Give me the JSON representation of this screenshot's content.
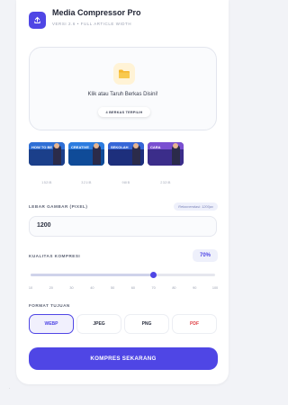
{
  "header": {
    "title": "Media Compressor Pro",
    "subtitle": "VERSI 2.6 • FULL ARTICLE WIDTH"
  },
  "dropzone": {
    "prompt": "Klik atau Taruh Berkas Disini!",
    "selected_count": "4 BERKAS TERPILIH"
  },
  "thumbnails": [
    {
      "text": "HOW TO BE",
      "label": "152IB",
      "colors": [
        "#2e6fd6",
        "#1b3f8a"
      ]
    },
    {
      "text": "CREATIVE",
      "label": "321IB",
      "colors": [
        "#2c7de0",
        "#0f4b98"
      ]
    },
    {
      "text": "SEKOLAH",
      "label": "98IB",
      "colors": [
        "#3566d8",
        "#1d2f7c"
      ]
    },
    {
      "text": "CARA",
      "label": "232IB",
      "colors": [
        "#7a4fd1",
        "#3b2d8a"
      ]
    }
  ],
  "width": {
    "label": "LEBAR GAMBAR (PIXEL)",
    "recommend": "Rekomendasi: 1200px",
    "value": "1200"
  },
  "quality": {
    "label": "KUALITAS KOMPRESI",
    "value_text": "70%",
    "value": 70,
    "min": 10,
    "max": 100,
    "ticks": [
      "10",
      "20",
      "30",
      "40",
      "50",
      "60",
      "70",
      "80",
      "90",
      "100"
    ]
  },
  "format": {
    "label": "FORMAT TUJUAN",
    "options": [
      "WEBP",
      "JPEG",
      "PNG",
      "PDF"
    ],
    "selected": "WEBP"
  },
  "actions": {
    "compress": "KOMPRES SEKARANG"
  },
  "footer_mark": ".",
  "colors": {
    "accent": "#4f46e5",
    "pdf": "#e0454a"
  }
}
